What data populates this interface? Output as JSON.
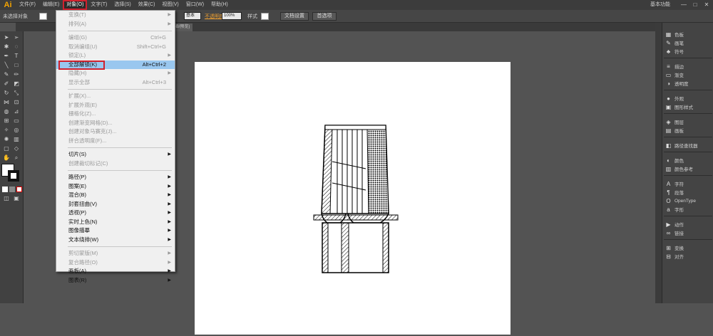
{
  "app": {
    "logo": "Ai"
  },
  "menubar": {
    "items": [
      "文件(F)",
      "编辑(E)",
      "对象(O)",
      "文字(T)",
      "选择(S)",
      "效果(C)",
      "视图(V)",
      "窗口(W)",
      "帮助(H)"
    ],
    "workspace": "基本功能",
    "window_buttons": [
      "—",
      "□",
      "✕"
    ]
  },
  "controlbar": {
    "selection_status": "未选择对象",
    "stroke_weight": "基本",
    "opacity_label": "不透明度",
    "opacity_value": "100%",
    "style_label": "样式",
    "doc_setup": "文档设置",
    "preferences": "首选项"
  },
  "tabbar": {
    "doc_tab": "未标题-1* @ ... (RGB/预览)"
  },
  "object_menu": {
    "groups": [
      [
        {
          "label": "变换(T)",
          "shortcut": "",
          "submenu": true,
          "disabled": true
        },
        {
          "label": "排列(A)",
          "shortcut": "",
          "submenu": true,
          "disabled": true
        }
      ],
      [
        {
          "label": "编组(G)",
          "shortcut": "Ctrl+G",
          "submenu": false,
          "disabled": true
        },
        {
          "label": "取消编组(U)",
          "shortcut": "Shift+Ctrl+G",
          "submenu": false,
          "disabled": true
        },
        {
          "label": "锁定(L)",
          "shortcut": "",
          "submenu": true,
          "disabled": true
        },
        {
          "label": "全部解锁(K)",
          "shortcut": "Alt+Ctrl+2",
          "submenu": false,
          "disabled": false,
          "highlight": true
        },
        {
          "label": "隐藏(H)",
          "shortcut": "",
          "submenu": true,
          "disabled": true
        },
        {
          "label": "显示全部",
          "shortcut": "Alt+Ctrl+3",
          "submenu": false,
          "disabled": true
        }
      ],
      [
        {
          "label": "扩展(X)...",
          "shortcut": "",
          "submenu": false,
          "disabled": true
        },
        {
          "label": "扩展外观(E)",
          "shortcut": "",
          "submenu": false,
          "disabled": true
        },
        {
          "label": "栅格化(Z)...",
          "shortcut": "",
          "submenu": false,
          "disabled": true
        },
        {
          "label": "创建渐变网格(D)...",
          "shortcut": "",
          "submenu": false,
          "disabled": true
        },
        {
          "label": "创建对象马赛克(J)...",
          "shortcut": "",
          "submenu": false,
          "disabled": true
        },
        {
          "label": "拼合透明度(F)...",
          "shortcut": "",
          "submenu": false,
          "disabled": true
        }
      ],
      [
        {
          "label": "切片(S)",
          "shortcut": "",
          "submenu": true,
          "disabled": false
        },
        {
          "label": "创建裁切标记(C)",
          "shortcut": "",
          "submenu": false,
          "disabled": true
        }
      ],
      [
        {
          "label": "路径(P)",
          "shortcut": "",
          "submenu": true,
          "disabled": false
        },
        {
          "label": "图案(E)",
          "shortcut": "",
          "submenu": true,
          "disabled": false
        },
        {
          "label": "混合(B)",
          "shortcut": "",
          "submenu": true,
          "disabled": false
        },
        {
          "label": "封套扭曲(V)",
          "shortcut": "",
          "submenu": true,
          "disabled": false
        },
        {
          "label": "透视(P)",
          "shortcut": "",
          "submenu": true,
          "disabled": false
        },
        {
          "label": "实时上色(N)",
          "shortcut": "",
          "submenu": true,
          "disabled": false
        },
        {
          "label": "图像描摹",
          "shortcut": "",
          "submenu": true,
          "disabled": false
        },
        {
          "label": "文本绕排(W)",
          "shortcut": "",
          "submenu": true,
          "disabled": false
        }
      ],
      [
        {
          "label": "剪切蒙版(M)",
          "shortcut": "",
          "submenu": true,
          "disabled": true
        },
        {
          "label": "复合路径(O)",
          "shortcut": "",
          "submenu": true,
          "disabled": true
        },
        {
          "label": "画板(A)",
          "shortcut": "",
          "submenu": true,
          "disabled": false
        },
        {
          "label": "图表(R)",
          "shortcut": "",
          "submenu": true,
          "disabled": false
        }
      ]
    ]
  },
  "right_panel": {
    "items": [
      {
        "icon": "color-swatch-icon",
        "label": "色板",
        "glyph": "▦"
      },
      {
        "icon": "brush-icon",
        "label": "画笔",
        "glyph": "✎"
      },
      {
        "icon": "symbol-icon",
        "label": "符号",
        "glyph": "♣"
      },
      {
        "icon": "stroke-icon",
        "label": "描边",
        "glyph": "≡"
      },
      {
        "icon": "gradient-icon",
        "label": "渐变",
        "glyph": "▭"
      },
      {
        "icon": "transparency-icon",
        "label": "透明度",
        "glyph": "◑"
      },
      {
        "icon": "appearance-icon",
        "label": "外观",
        "glyph": "●"
      },
      {
        "icon": "graphic-styles-icon",
        "label": "图形样式",
        "glyph": "▣"
      },
      {
        "icon": "layers-icon",
        "label": "图层",
        "glyph": "◈"
      },
      {
        "icon": "artboards-icon",
        "label": "画板",
        "glyph": "▤"
      },
      {
        "icon": "pathfinder-icon",
        "label": "路径查找器",
        "glyph": "◧"
      },
      {
        "icon": "color-icon",
        "label": "颜色",
        "glyph": "◐"
      },
      {
        "icon": "color-guide-icon",
        "label": "颜色参考",
        "glyph": "▥"
      },
      {
        "icon": "character-icon",
        "label": "字符",
        "glyph": "A"
      },
      {
        "icon": "paragraph-icon",
        "label": "段落",
        "glyph": "¶"
      },
      {
        "icon": "opentype-icon",
        "label": "OpenType",
        "glyph": "O"
      },
      {
        "icon": "glyphs-icon",
        "label": "字形",
        "glyph": "a"
      },
      {
        "icon": "actions-icon",
        "label": "动作",
        "glyph": "▶"
      },
      {
        "icon": "links-icon",
        "label": "链接",
        "glyph": "∞"
      },
      {
        "icon": "transform-icon",
        "label": "变换",
        "glyph": "⊞"
      },
      {
        "icon": "align-icon",
        "label": "对齐",
        "glyph": "⊟"
      }
    ]
  }
}
